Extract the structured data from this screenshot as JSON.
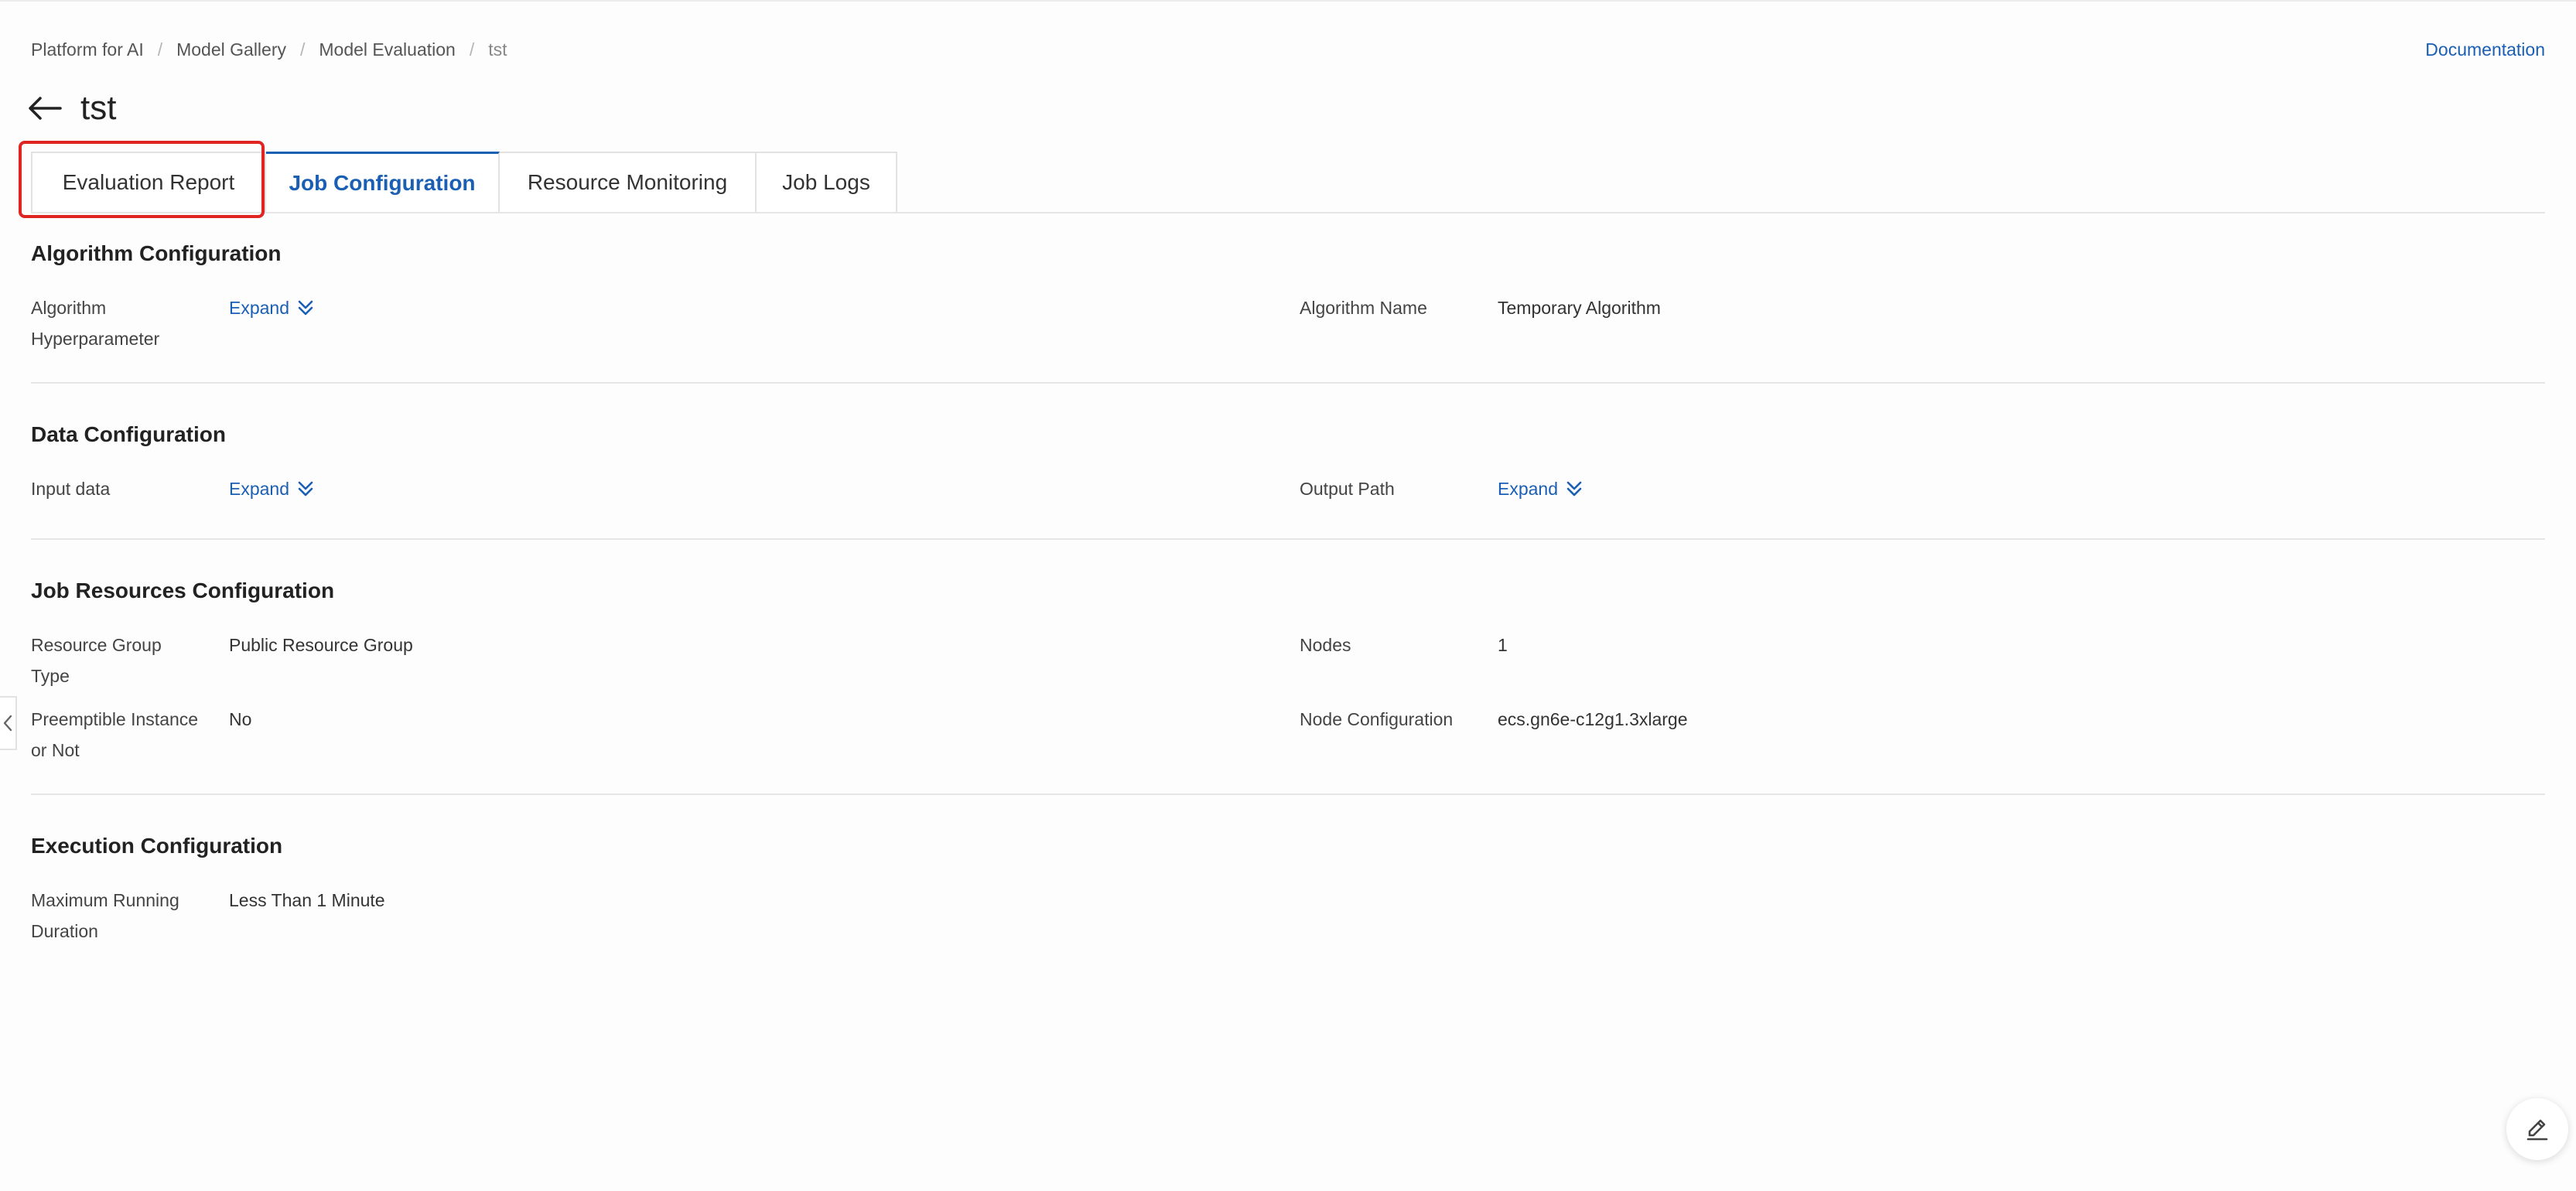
{
  "breadcrumb": [
    "Platform for AI",
    "Model Gallery",
    "Model Evaluation",
    "tst"
  ],
  "header": {
    "documentation": "Documentation",
    "title": "tst"
  },
  "tabs": [
    {
      "label": "Evaluation Report",
      "active": false
    },
    {
      "label": "Job Configuration",
      "active": true
    },
    {
      "label": "Resource Monitoring",
      "active": false
    },
    {
      "label": "Job Logs",
      "active": false
    }
  ],
  "sections": {
    "algorithm": {
      "title": "Algorithm Configuration",
      "hyperparameter_label": "Algorithm Hyperparameter",
      "hyperparameter_action": "Expand",
      "name_label": "Algorithm Name",
      "name_value": "Temporary Algorithm"
    },
    "data": {
      "title": "Data Configuration",
      "input_label": "Input data",
      "input_action": "Expand",
      "output_label": "Output Path",
      "output_action": "Expand"
    },
    "resources": {
      "title": "Job Resources Configuration",
      "group_type_label": "Resource Group Type",
      "group_type_value": "Public Resource Group",
      "nodes_label": "Nodes",
      "nodes_value": "1",
      "preemptible_label": "Preemptible Instance or Not",
      "preemptible_value": "No",
      "node_config_label": "Node Configuration",
      "node_config_value": "ecs.gn6e-c12g1.3xlarge"
    },
    "execution": {
      "title": "Execution Configuration",
      "max_duration_label": "Maximum Running Duration",
      "max_duration_value": "Less Than 1 Minute"
    }
  },
  "colors": {
    "accent": "#1a5fb4",
    "highlight": "#e02424"
  },
  "icons": {
    "back": "arrow-left-icon",
    "expand": "double-chevron-down-icon",
    "collapse_handle": "chevron-left-icon",
    "edit": "pencil-icon"
  }
}
